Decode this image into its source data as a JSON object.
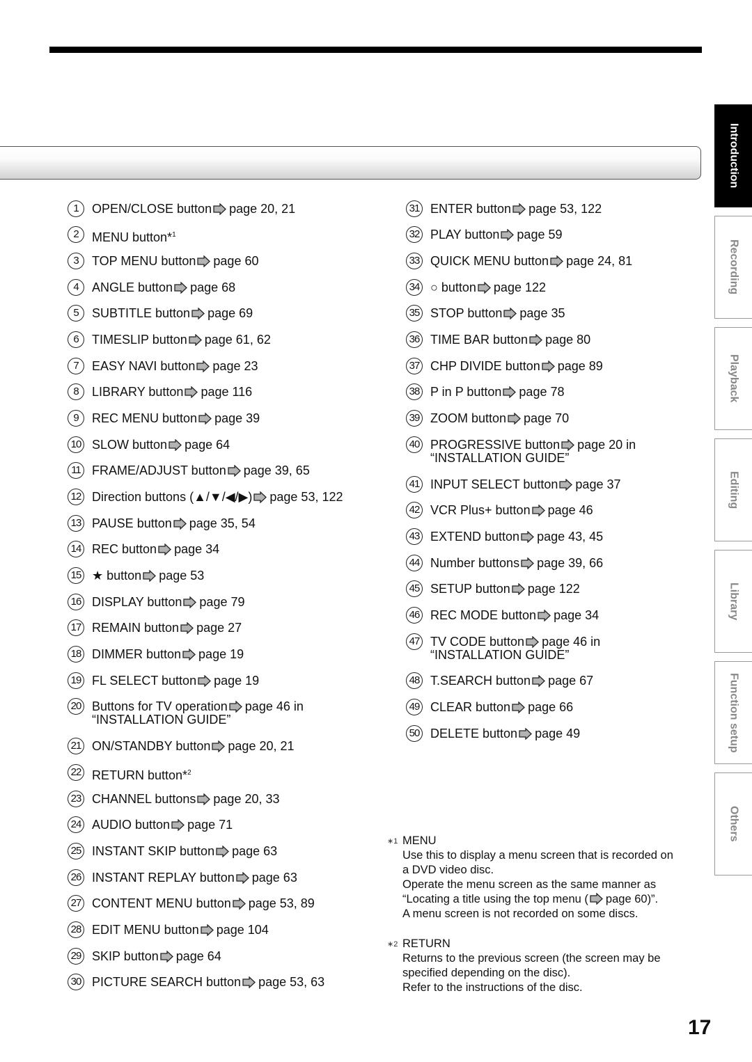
{
  "side_tabs": [
    {
      "label": "Introduction",
      "active": true
    },
    {
      "label": "Recording",
      "active": false
    },
    {
      "label": "Playback",
      "active": false
    },
    {
      "label": "Editing",
      "active": false
    },
    {
      "label": "Library",
      "active": false
    },
    {
      "label": "Function setup",
      "active": false
    },
    {
      "label": "Others",
      "active": false
    }
  ],
  "left_items": [
    {
      "num": "1",
      "label": "OPEN/CLOSE button",
      "ref": "page 20, 21"
    },
    {
      "num": "2",
      "label": "MENU button*",
      "sup": "1",
      "ref": ""
    },
    {
      "num": "3",
      "label": "TOP MENU button",
      "ref": "page 60"
    },
    {
      "num": "4",
      "label": "ANGLE button",
      "ref": "page 68"
    },
    {
      "num": "5",
      "label": "SUBTITLE button",
      "ref": "page 69"
    },
    {
      "num": "6",
      "label": "TIMESLIP button",
      "ref": "page 61, 62"
    },
    {
      "num": "7",
      "label": "EASY NAVI button",
      "ref": "page 23"
    },
    {
      "num": "8",
      "label": "LIBRARY button",
      "ref": "page 116"
    },
    {
      "num": "9",
      "label": "REC MENU button",
      "ref": "page 39"
    },
    {
      "num": "10",
      "label": "SLOW button",
      "ref": "page 64"
    },
    {
      "num": "11",
      "label": "FRAME/ADJUST button",
      "ref": "page 39, 65"
    },
    {
      "num": "12",
      "label": "Direction buttons (▲/▼/◀/▶)",
      "ref": "page 53, 122"
    },
    {
      "num": "13",
      "label": "PAUSE button",
      "ref": "page 35, 54"
    },
    {
      "num": "14",
      "label": "REC button",
      "ref": "page 34"
    },
    {
      "num": "15",
      "label": "★ button",
      "ref": "page 53"
    },
    {
      "num": "16",
      "label": "DISPLAY button",
      "ref": "page 79"
    },
    {
      "num": "17",
      "label": "REMAIN button",
      "ref": "page 27"
    },
    {
      "num": "18",
      "label": "DIMMER button",
      "ref": "page 19"
    },
    {
      "num": "19",
      "label": "FL SELECT button",
      "ref": "page 19"
    },
    {
      "num": "20",
      "label": "Buttons for TV operation",
      "ref": "page 46 in",
      "line2": "“INSTALLATION GUIDE”"
    },
    {
      "num": "21",
      "label": "ON/STANDBY button",
      "ref": "page 20, 21"
    },
    {
      "num": "22",
      "label": "RETURN button*",
      "sup": "2",
      "ref": ""
    },
    {
      "num": "23",
      "label": "CHANNEL buttons",
      "ref": "page 20, 33"
    },
    {
      "num": "24",
      "label": "AUDIO button",
      "ref": "page 71"
    },
    {
      "num": "25",
      "label": "INSTANT SKIP button",
      "ref": "page 63"
    },
    {
      "num": "26",
      "label": "INSTANT REPLAY button",
      "ref": "page 63"
    },
    {
      "num": "27",
      "label": "CONTENT MENU button",
      "ref": "page 53, 89"
    },
    {
      "num": "28",
      "label": "EDIT MENU button",
      "ref": "page 104"
    },
    {
      "num": "29",
      "label": "SKIP button",
      "ref": "page 64"
    },
    {
      "num": "30",
      "label": "PICTURE SEARCH button",
      "ref": "page 53, 63"
    }
  ],
  "right_items": [
    {
      "num": "31",
      "label": "ENTER button",
      "ref": "page 53, 122"
    },
    {
      "num": "32",
      "label": "PLAY button",
      "ref": "page 59"
    },
    {
      "num": "33",
      "label": "QUICK MENU button",
      "ref": "page 24, 81"
    },
    {
      "num": "34",
      "label": "○ button",
      "ref": "page 122"
    },
    {
      "num": "35",
      "label": "STOP button",
      "ref": "page 35"
    },
    {
      "num": "36",
      "label": "TIME BAR button",
      "ref": "page 80"
    },
    {
      "num": "37",
      "label": "CHP DIVIDE button",
      "ref": "page 89"
    },
    {
      "num": "38",
      "label": "P in P button",
      "ref": "page 78"
    },
    {
      "num": "39",
      "label": "ZOOM button",
      "ref": "page 70"
    },
    {
      "num": "40",
      "label": "PROGRESSIVE button",
      "ref": "page 20 in",
      "line2": "“INSTALLATION GUIDE”"
    },
    {
      "num": "41",
      "label": "INPUT SELECT button",
      "ref": "page 37"
    },
    {
      "num": "42",
      "label": "VCR Plus+ button",
      "ref": "page 46"
    },
    {
      "num": "43",
      "label": "EXTEND button",
      "ref": "page 43, 45"
    },
    {
      "num": "44",
      "label": "Number buttons",
      "ref": "page 39, 66"
    },
    {
      "num": "45",
      "label": "SETUP button",
      "ref": "page 122"
    },
    {
      "num": "46",
      "label": "REC MODE button",
      "ref": "page 34"
    },
    {
      "num": "47",
      "label": "TV CODE button",
      "ref": "page 46 in",
      "line2": "“INSTALLATION GUIDE”"
    },
    {
      "num": "48",
      "label": "T.SEARCH button",
      "ref": "page 67"
    },
    {
      "num": "49",
      "label": "CLEAR button",
      "ref": "page 66"
    },
    {
      "num": "50",
      "label": "DELETE button",
      "ref": "page 49"
    }
  ],
  "notes": [
    {
      "mark": "∗1",
      "title": "MENU",
      "lines": [
        "Use this to display a menu screen that is recorded on",
        "a DVD video disc.",
        "Operate the menu screen as the same manner as",
        "“Locating a title using the top menu (",
        "A menu screen is not recorded on some discs."
      ],
      "inline_ref": "page 60)”."
    },
    {
      "mark": "∗2",
      "title": "RETURN",
      "lines": [
        "Returns to the previous screen (the screen may be",
        "specified depending on the disc).",
        "Refer to the instructions of the disc."
      ]
    }
  ],
  "page_number": "17",
  "colors": {
    "arrow_fill": "#b3b3b3",
    "active_tab": "#000000",
    "inactive_tab_text": "#888888"
  }
}
